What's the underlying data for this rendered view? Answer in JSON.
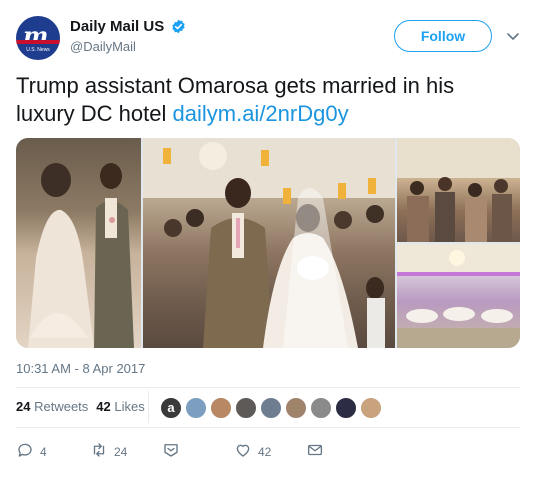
{
  "account": {
    "display_name": "Daily Mail US",
    "handle": "@DailyMail",
    "avatar_sub": "U.S. News",
    "verified": true,
    "verified_icon": "verified-badge-icon"
  },
  "follow_button": {
    "label": "Follow"
  },
  "more_menu": {
    "icon": "chevron-down-icon"
  },
  "tweet": {
    "text": "Trump assistant Omarosa gets married in his luxury DC hotel ",
    "link": "dailym.ai/2nrDg0y"
  },
  "media": {
    "photos": [
      {
        "description_icon": "photo-wedding-couple"
      },
      {
        "description_icon": "photo-wedding-toast"
      },
      {
        "description_icon": "photo-wedding-guests"
      },
      {
        "description_icon": "photo-wedding-ballroom"
      }
    ]
  },
  "timestamp": "10:31 AM - 8 Apr 2017",
  "stats": {
    "retweets_count": "24",
    "retweets_label": "Retweets",
    "likes_count": "42",
    "likes_label": "Likes"
  },
  "likers": [
    {
      "glyph": "a",
      "color": "#3a3a3a"
    },
    {
      "glyph": "",
      "color": "#7c9fbf"
    },
    {
      "glyph": "",
      "color": "#b88763"
    },
    {
      "glyph": "",
      "color": "#5d5a58"
    },
    {
      "glyph": "",
      "color": "#6f7d91"
    },
    {
      "glyph": "",
      "color": "#a0836b"
    },
    {
      "glyph": "",
      "color": "#8a8a8a"
    },
    {
      "glyph": "",
      "color": "#2c2d44"
    },
    {
      "glyph": "",
      "color": "#c9a27e"
    }
  ],
  "actions": {
    "reply_count": "4",
    "retweet_count": "24",
    "like_count": "42"
  },
  "colors": {
    "accent": "#1da1f2",
    "link": "#1b95e0",
    "muted": "#657786"
  }
}
